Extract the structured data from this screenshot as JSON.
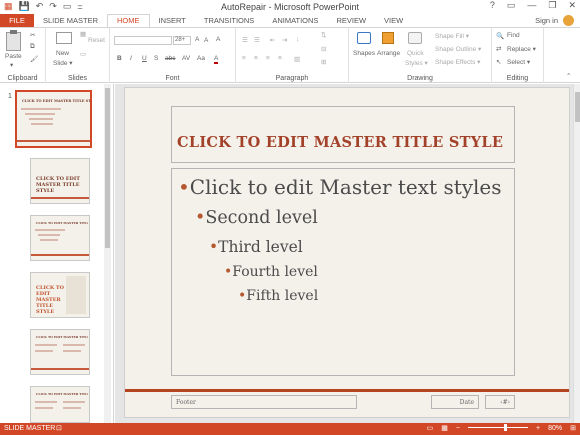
{
  "window": {
    "title": "AutoRepair - Microsoft PowerPoint",
    "controls": [
      "?",
      "▭",
      "—",
      "❐",
      "✕"
    ]
  },
  "qat": [
    "▦",
    "💾",
    "↶",
    "↷",
    "▭",
    "="
  ],
  "tabs": [
    "FILE",
    "SLIDE MASTER",
    "HOME",
    "INSERT",
    "TRANSITIONS",
    "ANIMATIONS",
    "REVIEW",
    "VIEW"
  ],
  "active_tab": "HOME",
  "account": {
    "label": "Sign in"
  },
  "ribbon": {
    "clipboard": {
      "label": "Clipboard",
      "paste": "Paste"
    },
    "slides": {
      "label": "Slides",
      "new_slide": "New",
      "new_slide_2": "Slide ▾",
      "reset": "Reset"
    },
    "font": {
      "label": "Font",
      "size": "28+",
      "buttons": [
        "B",
        "I",
        "U",
        "S",
        "abc",
        "AV",
        "Aa",
        "A"
      ]
    },
    "paragraph": {
      "label": "Paragraph"
    },
    "drawing": {
      "label": "Drawing",
      "shapes": "Shapes",
      "arrange": "Arrange",
      "quick_styles": "Quick",
      "quick_styles_2": "Styles ▾",
      "shape_fill": "Shape Fill ▾",
      "shape_outline": "Shape Outline ▾",
      "shape_effects": "Shape Effects ▾"
    },
    "editing": {
      "label": "Editing",
      "find": "Find",
      "replace": "Replace ▾",
      "select": "Select ▾"
    }
  },
  "thumbnails": {
    "first_number": "1",
    "items": [
      {
        "title": "CLICK TO EDIT MASTER TITLE STYLE"
      },
      {
        "title": "CLICK TO EDIT MASTER TITLE STYLE"
      },
      {
        "title": "CLICK TO EDIT MASTER TITLE STYLE"
      },
      {
        "title": "CLICK TO EDIT MASTER TITLE STYLE"
      },
      {
        "title": "CLICK TO EDIT MASTER TITLE STYLE"
      },
      {
        "title": "CLICK TO EDIT MASTER TITLE STYLE"
      }
    ]
  },
  "slide": {
    "title": "CLICK TO EDIT MASTER TITLE STYLE",
    "levels": [
      "Click to edit Master text styles",
      "Second level",
      "Third level",
      "Fourth level",
      "Fifth level"
    ],
    "footer": "Footer",
    "date": "Date",
    "number": "‹#›"
  },
  "status": {
    "mode": "SLIDE MASTER",
    "zoom": "80%"
  },
  "colors": {
    "accent": "#d24726",
    "title": "#a3422a",
    "bar": "#b5451e"
  }
}
